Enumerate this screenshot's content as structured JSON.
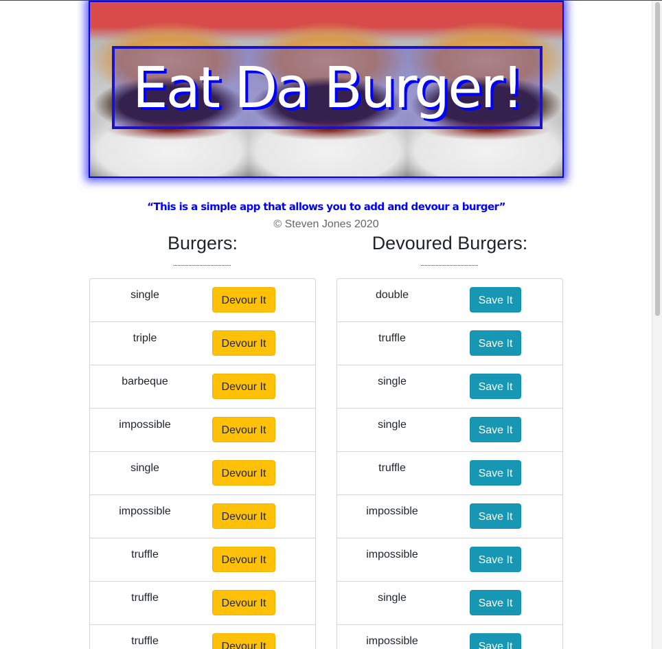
{
  "header": {
    "title": "Eat Da Burger!",
    "tagline": "“This is a simple app that allows you to add and devour a burger”",
    "copyright": "© Steven Jones 2020"
  },
  "burgers": {
    "heading": "Burgers:",
    "button_label": "Devour It",
    "items": [
      "single",
      "triple",
      "barbeque",
      "impossible",
      "single",
      "impossible",
      "truffle",
      "truffle",
      "truffle"
    ]
  },
  "devoured": {
    "heading": "Devoured Burgers:",
    "button_label": "Save It",
    "items": [
      "double",
      "truffle",
      "single",
      "single",
      "truffle",
      "impossible",
      "impossible",
      "single",
      "impossible"
    ]
  },
  "colors": {
    "accent_blue": "#0000ff",
    "devour_button": "#ffc107",
    "save_button": "#1797b3"
  }
}
